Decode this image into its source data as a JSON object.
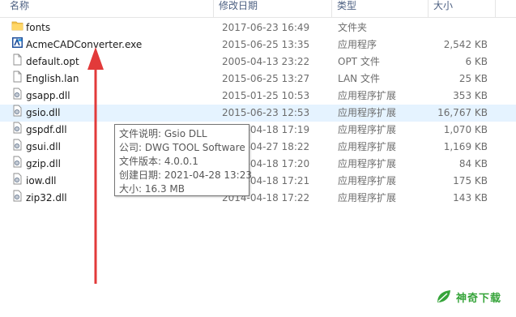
{
  "columns": {
    "name": "名称",
    "date": "修改日期",
    "type": "类型",
    "size": "大小"
  },
  "files": [
    {
      "icon": "folder-icon",
      "name": "fonts",
      "date": "2017-06-23 16:49",
      "type": "文件夹",
      "size": ""
    },
    {
      "icon": "exe-icon",
      "name": "AcmeCADConverter.exe",
      "date": "2015-06-25 13:35",
      "type": "应用程序",
      "size": "2,542 KB"
    },
    {
      "icon": "file-icon",
      "name": "default.opt",
      "date": "2005-04-13 23:22",
      "type": "OPT 文件",
      "size": "6 KB"
    },
    {
      "icon": "file-icon",
      "name": "English.lan",
      "date": "2015-06-25 13:27",
      "type": "LAN 文件",
      "size": "25 KB"
    },
    {
      "icon": "dll-icon",
      "name": "gsapp.dll",
      "date": "2015-01-25 10:53",
      "type": "应用程序扩展",
      "size": "353 KB"
    },
    {
      "icon": "dll-icon",
      "name": "gsio.dll",
      "date": "2015-06-23 12:53",
      "type": "应用程序扩展",
      "size": "16,767 KB"
    },
    {
      "icon": "dll-icon",
      "name": "gspdf.dll",
      "date": "2014-04-18 17:19",
      "type": "应用程序扩展",
      "size": "1,070 KB"
    },
    {
      "icon": "dll-icon",
      "name": "gsui.dll",
      "date": "2014-04-27 18:22",
      "type": "应用程序扩展",
      "size": "1,169 KB"
    },
    {
      "icon": "dll-icon",
      "name": "gzip.dll",
      "date": "2014-04-18 17:20",
      "type": "应用程序扩展",
      "size": "84 KB"
    },
    {
      "icon": "dll-icon",
      "name": "iow.dll",
      "date": "2014-04-18 17:21",
      "type": "应用程序扩展",
      "size": "175 KB"
    },
    {
      "icon": "dll-icon",
      "name": "zip32.dll",
      "date": "2014-04-18 17:22",
      "type": "应用程序扩展",
      "size": "143 KB"
    }
  ],
  "tooltip": {
    "description": "文件说明: Gsio DLL",
    "company": "公司: DWG TOOL Software",
    "version": "文件版本: 4.0.0.1",
    "created": "创建日期: 2021-04-28 13:23",
    "size": "大小: 16.3 MB"
  },
  "watermark": {
    "text": "神奇下载",
    "color": "#36a43a"
  },
  "colors": {
    "hover_row": "#e5f3ff",
    "header_text": "#4d6082",
    "arrow": "#e23a3a"
  }
}
